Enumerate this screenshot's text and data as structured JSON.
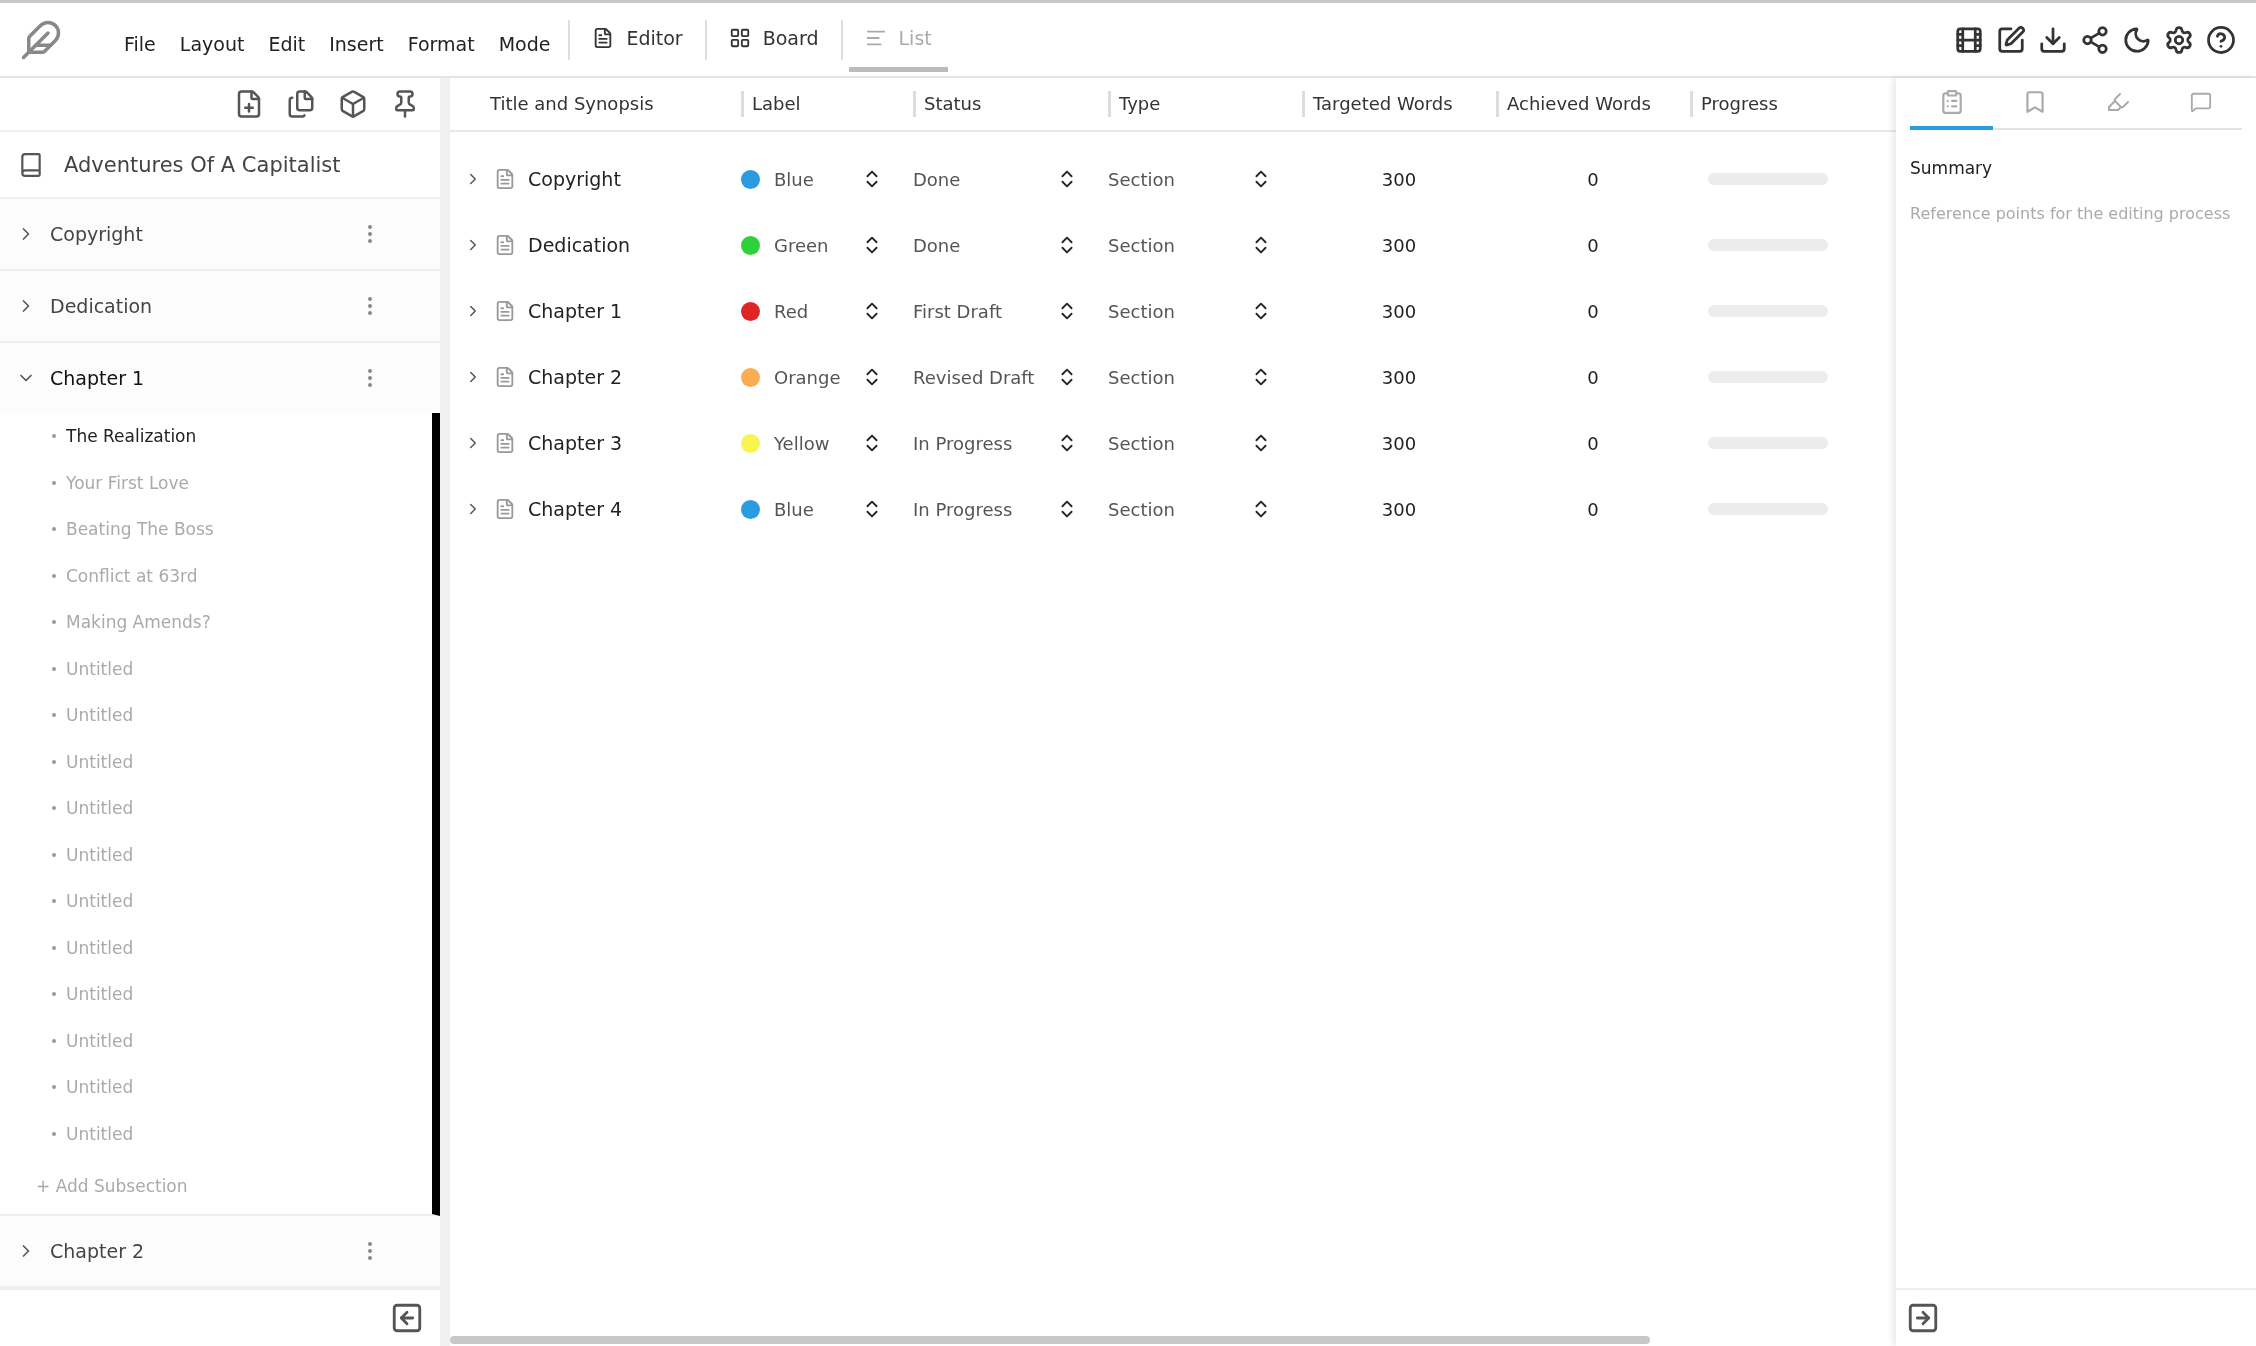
{
  "menu": [
    "File",
    "Layout",
    "Edit",
    "Insert",
    "Format",
    "Mode"
  ],
  "views": [
    {
      "label": "Editor",
      "kind": "editor",
      "selected": false
    },
    {
      "label": "Board",
      "kind": "board",
      "selected": false
    },
    {
      "label": "List",
      "kind": "list",
      "selected": true
    }
  ],
  "sidebar": {
    "book_title": "Adventures Of A Capitalist",
    "items": [
      {
        "title": "Copyright",
        "expanded": false
      },
      {
        "title": "Dedication",
        "expanded": false
      },
      {
        "title": "Chapter 1",
        "expanded": true,
        "add_label": "+ Add Subsection",
        "children": [
          {
            "title": "The Realization",
            "selected": true
          },
          {
            "title": "Your First Love",
            "selected": false
          },
          {
            "title": "Beating The Boss",
            "selected": false
          },
          {
            "title": "Conflict at 63rd",
            "selected": false
          },
          {
            "title": "Making Amends?",
            "selected": false
          },
          {
            "title": "Untitled",
            "selected": false
          },
          {
            "title": "Untitled",
            "selected": false
          },
          {
            "title": "Untitled",
            "selected": false
          },
          {
            "title": "Untitled",
            "selected": false
          },
          {
            "title": "Untitled",
            "selected": false
          },
          {
            "title": "Untitled",
            "selected": false
          },
          {
            "title": "Untitled",
            "selected": false
          },
          {
            "title": "Untitled",
            "selected": false
          },
          {
            "title": "Untitled",
            "selected": false
          },
          {
            "title": "Untitled",
            "selected": false
          },
          {
            "title": "Untitled",
            "selected": false
          }
        ]
      },
      {
        "title": "Chapter 2",
        "expanded": false
      }
    ]
  },
  "table": {
    "columns": [
      "Title and Synopsis",
      "Label",
      "Status",
      "Type",
      "Targeted Words",
      "Achieved Words",
      "Progress"
    ],
    "rows": [
      {
        "title": "Copyright",
        "label": "Blue",
        "color": "#2b9be0",
        "status": "Done",
        "type": "Section",
        "targeted": "300",
        "achieved": "0",
        "level": 0
      },
      {
        "title": "Dedication",
        "label": "Green",
        "color": "#2ed13a",
        "status": "Done",
        "type": "Section",
        "targeted": "300",
        "achieved": "0",
        "level": 0
      },
      {
        "title": "Chapter 1",
        "label": "Red",
        "color": "#de2626",
        "status": "First Draft",
        "type": "Section",
        "targeted": "300",
        "achieved": "0",
        "level": 0
      },
      {
        "title": "Chapter 2",
        "label": "Orange",
        "color": "#f9ac52",
        "status": "Revised Draft",
        "type": "Section",
        "targeted": "300",
        "achieved": "0",
        "level": 0
      },
      {
        "title": "Chapter 3",
        "label": "Yellow",
        "color": "#f8f552",
        "status": "In Progress",
        "type": "Section",
        "targeted": "300",
        "achieved": "0",
        "level": 0
      },
      {
        "title": "Chapter 4",
        "label": "Blue",
        "color": "#2b9be0",
        "status": "In Progress",
        "type": "Section",
        "targeted": "300",
        "achieved": "0",
        "level": 0
      }
    ]
  },
  "right_panel": {
    "tabs": [
      {
        "kind": "notes",
        "selected": true
      },
      {
        "kind": "bookmarks",
        "selected": false
      },
      {
        "kind": "edit",
        "selected": false
      },
      {
        "kind": "comments",
        "selected": false
      }
    ],
    "heading": "Summary",
    "placeholder": "Reference points for the editing process"
  }
}
